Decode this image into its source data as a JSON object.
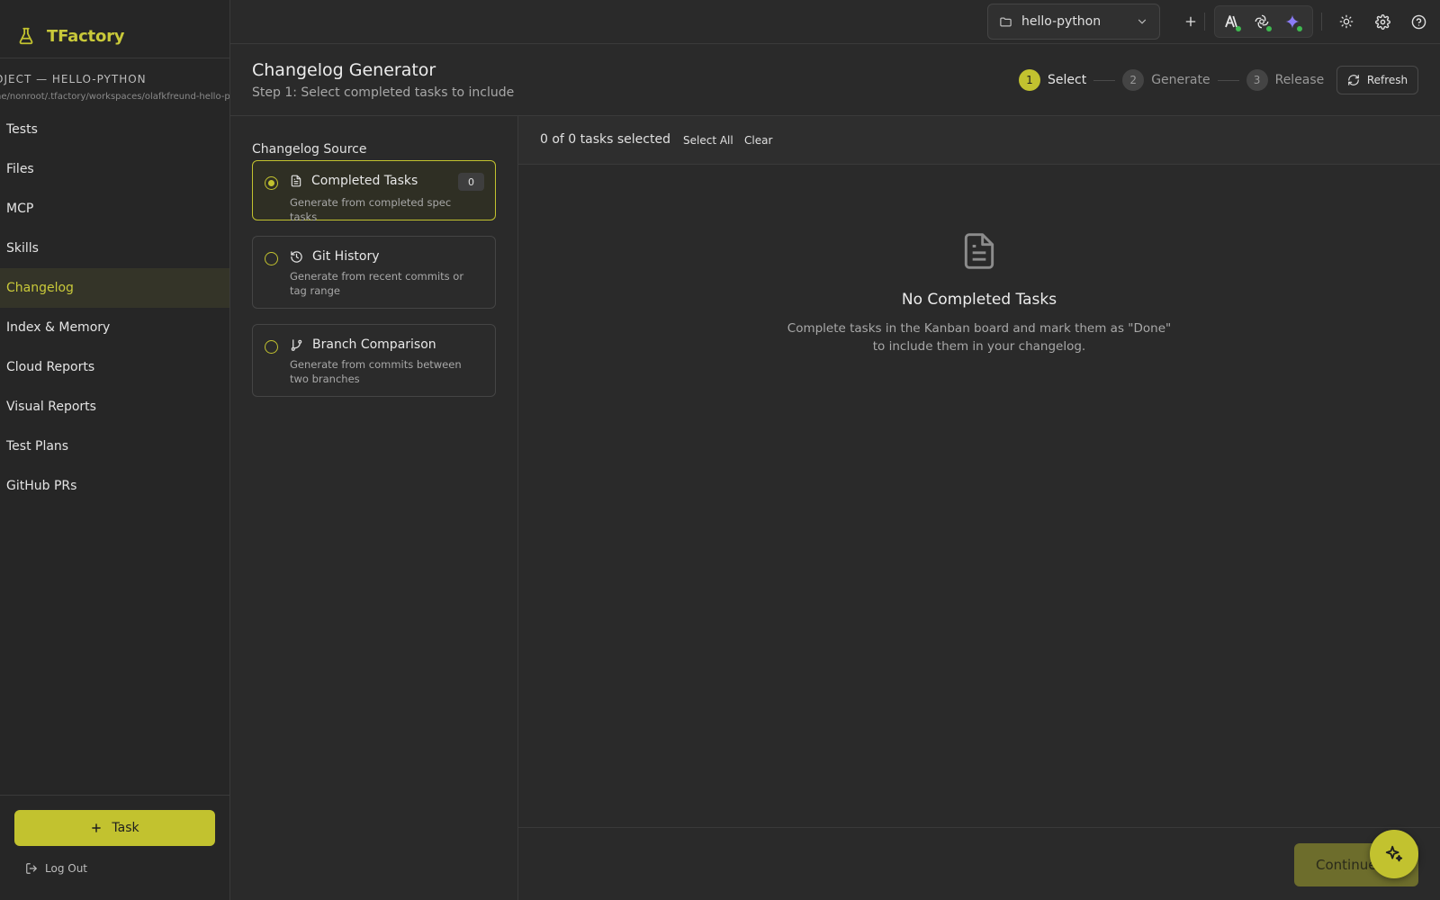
{
  "app": {
    "name_initial": "T",
    "name_rest": "Factory"
  },
  "sidebar": {
    "project_title": "OJECT — HELLO-PYTHON",
    "project_path": "ne/nonroot/.tfactory/workspaces/olafkfreund-hello-python",
    "items": [
      {
        "label": "Tests"
      },
      {
        "label": "Files"
      },
      {
        "label": "MCP"
      },
      {
        "label": "Skills"
      },
      {
        "label": "Changelog",
        "active": true
      },
      {
        "label": "Index & Memory"
      },
      {
        "label": "Cloud Reports"
      },
      {
        "label": "Visual Reports"
      },
      {
        "label": "Test Plans"
      },
      {
        "label": "GitHub PRs"
      }
    ],
    "task_button": "Task",
    "logout": "Log Out"
  },
  "topbar": {
    "project": "hello-python",
    "icons": [
      "folder-icon",
      "chevron-down-icon",
      "plus-icon",
      "anthropic-icon",
      "openai-icon",
      "gemini-icon",
      "sun-icon",
      "gear-icon",
      "help-icon"
    ]
  },
  "header": {
    "title": "Changelog Generator",
    "subtitle": "Step 1: Select completed tasks to include",
    "steps": [
      {
        "num": "1",
        "label": "Select",
        "active": true
      },
      {
        "num": "2",
        "label": "Generate",
        "active": false
      },
      {
        "num": "3",
        "label": "Release",
        "active": false
      }
    ],
    "refresh": "Refresh"
  },
  "source": {
    "title": "Changelog Source",
    "options": [
      {
        "title": "Completed Tasks",
        "desc": "Generate from completed spec tasks",
        "badge": "0",
        "selected": true
      },
      {
        "title": "Git History",
        "desc": "Generate from recent commits or tag range",
        "selected": false
      },
      {
        "title": "Branch Comparison",
        "desc": "Generate from commits between two branches",
        "selected": false
      }
    ]
  },
  "main": {
    "selected_count": "0 of 0 tasks selected",
    "select_all": "Select All",
    "clear": "Clear",
    "empty_title": "No Completed Tasks",
    "empty_desc": "Complete tasks in the Kanban board and mark them as \"Done\" to include them in your changelog.",
    "continue": "Continue"
  },
  "colors": {
    "accent": "#c2c22f",
    "background": "#2a2a2a",
    "sidebar": "#262626",
    "status_green": "#3fb950"
  }
}
